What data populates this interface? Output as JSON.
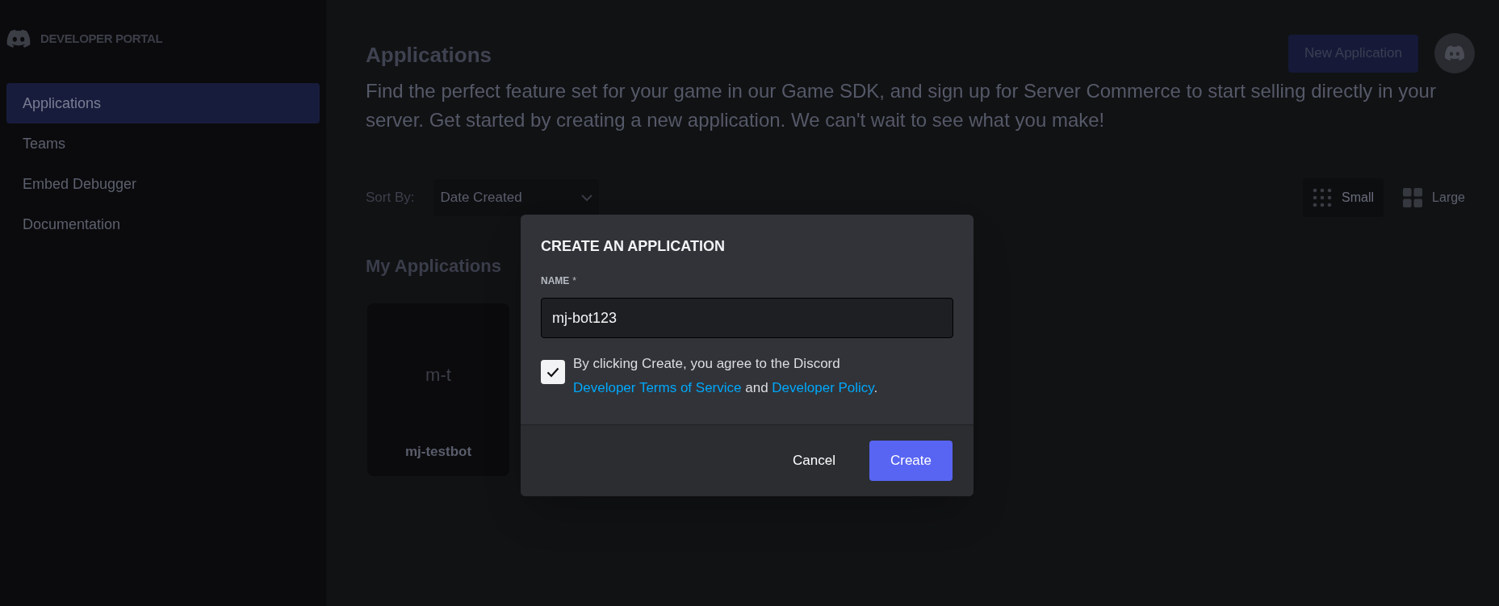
{
  "sidebar": {
    "logo_text": "DEVELOPER PORTAL",
    "items": [
      {
        "label": "Applications",
        "selected": true
      },
      {
        "label": "Teams",
        "selected": false
      },
      {
        "label": "Embed Debugger",
        "selected": false
      },
      {
        "label": "Documentation",
        "selected": false
      }
    ]
  },
  "header": {
    "title": "Applications",
    "new_button": "New Application",
    "description": "Find the perfect feature set for your game in our Game SDK, and sign up for Server Commerce to start selling directly in your server. Get started by creating a new application. We can't wait to see what you make!"
  },
  "sort": {
    "label": "Sort By:",
    "value": "Date Created"
  },
  "view_options": [
    {
      "kind": "small",
      "label": "Small",
      "selected": true
    },
    {
      "kind": "large",
      "label": "Large",
      "selected": false
    }
  ],
  "section_title": "My Applications",
  "apps": [
    {
      "initials": "m-t",
      "name": "mj-testbot"
    }
  ],
  "modal": {
    "title": "CREATE AN APPLICATION",
    "field_label": "NAME",
    "required_mark": "*",
    "value": "mj-bot123",
    "agreement": {
      "checked": true,
      "parts": [
        {
          "kind": "text",
          "text": "By clicking Create, you agree to the Discord "
        },
        {
          "kind": "link",
          "text": "Developer Terms of Service"
        },
        {
          "kind": "text",
          "text": " and "
        },
        {
          "kind": "link",
          "text": "Developer Policy"
        },
        {
          "kind": "text",
          "text": "."
        }
      ]
    },
    "buttons": [
      {
        "kind": "secondary",
        "label": "Cancel"
      },
      {
        "kind": "primary",
        "label": "Create"
      }
    ]
  }
}
